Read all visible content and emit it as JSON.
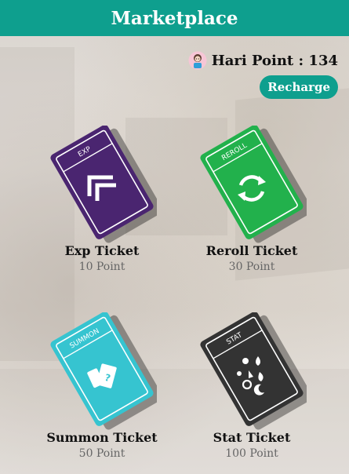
{
  "header": {
    "title": "Marketplace"
  },
  "points": {
    "label": "Hari Point : 134"
  },
  "recharge": {
    "label": "Recharge"
  },
  "tickets": [
    {
      "name": "Exp Ticket",
      "price": "10 Point",
      "tag": "EXP",
      "color": "#4a2570",
      "icon": "double-chevron-up-icon"
    },
    {
      "name": "Reroll Ticket",
      "price": "30 Point",
      "tag": "REROLL",
      "color": "#22b14c",
      "icon": "refresh-icon"
    },
    {
      "name": "Summon Ticket",
      "price": "50 Point",
      "tag": "SUMMON",
      "color": "#36c4d0",
      "icon": "summon-cards-icon"
    },
    {
      "name": "Stat Ticket",
      "price": "100 Point",
      "tag": "STAT",
      "color": "#333333",
      "icon": "stat-elements-icon"
    }
  ]
}
